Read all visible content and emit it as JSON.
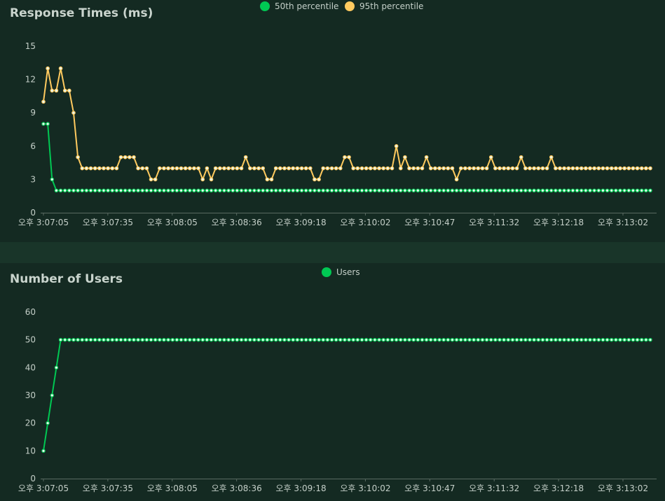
{
  "colors": {
    "background": "#142a22",
    "separator": "#193529",
    "p50": "#00c853",
    "p95": "#ffca5f",
    "users": "#00c853",
    "text": "#c4cfc8",
    "axis": "#5a6b62"
  },
  "chart_data": [
    {
      "type": "line",
      "title": "Response Times (ms)",
      "legend_position": "top-center",
      "x_tick_labels": [
        "오후 3:07:05",
        "오후 3:07:35",
        "오후 3:08:05",
        "오후 3:08:36",
        "오후 3:09:18",
        "오후 3:10:02",
        "오후 3:10:47",
        "오후 3:11:32",
        "오후 3:12:18",
        "오후 3:13:02"
      ],
      "ylim": [
        0,
        15
      ],
      "y_ticks": [
        0,
        3,
        6,
        9,
        12,
        15
      ],
      "series": [
        {
          "name": "50th percentile",
          "color": "#00c853",
          "values": [
            8,
            8,
            3,
            2,
            2,
            2,
            2,
            2,
            2,
            2,
            2,
            2,
            2,
            2,
            2,
            2,
            2,
            2,
            2,
            2,
            2,
            2,
            2,
            2,
            2,
            2,
            2,
            2,
            2,
            2,
            2,
            2,
            2,
            2,
            2,
            2,
            2,
            2,
            2,
            2,
            2,
            2,
            2,
            2,
            2,
            2,
            2,
            2,
            2,
            2,
            2,
            2,
            2,
            2,
            2,
            2,
            2,
            2,
            2,
            2,
            2,
            2,
            2,
            2,
            2,
            2,
            2,
            2,
            2,
            2,
            2,
            2,
            2,
            2,
            2,
            2,
            2,
            2,
            2,
            2,
            2,
            2,
            2,
            2,
            2,
            2,
            2,
            2,
            2,
            2,
            2,
            2,
            2,
            2,
            2,
            2,
            2,
            2,
            2,
            2,
            2,
            2,
            2,
            2,
            2,
            2,
            2,
            2,
            2,
            2,
            2,
            2,
            2,
            2,
            2,
            2,
            2,
            2,
            2,
            2,
            2,
            2,
            2,
            2,
            2,
            2,
            2,
            2,
            2,
            2,
            2,
            2,
            2,
            2,
            2,
            2,
            2,
            2,
            2,
            2,
            2,
            2
          ]
        },
        {
          "name": "95th percentile",
          "color": "#ffca5f",
          "values": [
            10,
            13,
            11,
            11,
            13,
            11,
            11,
            9,
            5,
            4,
            4,
            4,
            4,
            4,
            4,
            4,
            4,
            4,
            5,
            5,
            5,
            5,
            4,
            4,
            4,
            3,
            3,
            4,
            4,
            4,
            4,
            4,
            4,
            4,
            4,
            4,
            4,
            3,
            4,
            3,
            4,
            4,
            4,
            4,
            4,
            4,
            4,
            5,
            4,
            4,
            4,
            4,
            3,
            3,
            4,
            4,
            4,
            4,
            4,
            4,
            4,
            4,
            4,
            3,
            3,
            4,
            4,
            4,
            4,
            4,
            5,
            5,
            4,
            4,
            4,
            4,
            4,
            4,
            4,
            4,
            4,
            4,
            6,
            4,
            5,
            4,
            4,
            4,
            4,
            5,
            4,
            4,
            4,
            4,
            4,
            4,
            3,
            4,
            4,
            4,
            4,
            4,
            4,
            4,
            5,
            4,
            4,
            4,
            4,
            4,
            4,
            5,
            4,
            4,
            4,
            4,
            4,
            4,
            5,
            4,
            4,
            4,
            4,
            4,
            4,
            4,
            4,
            4,
            4,
            4,
            4,
            4,
            4,
            4,
            4,
            4,
            4,
            4,
            4,
            4,
            4,
            4
          ]
        }
      ]
    },
    {
      "type": "line",
      "title": "Number of Users",
      "legend_position": "top-center",
      "x_tick_labels": [
        "오후 3:07:05",
        "오후 3:07:35",
        "오후 3:08:05",
        "오후 3:08:36",
        "오후 3:09:18",
        "오후 3:10:02",
        "오후 3:10:47",
        "오후 3:11:32",
        "오후 3:12:18",
        "오후 3:13:02"
      ],
      "ylim": [
        0,
        60
      ],
      "y_ticks": [
        0,
        10,
        20,
        30,
        40,
        50,
        60
      ],
      "series": [
        {
          "name": "Users",
          "color": "#00c853",
          "values": [
            10,
            20,
            30,
            40,
            50,
            50,
            50,
            50,
            50,
            50,
            50,
            50,
            50,
            50,
            50,
            50,
            50,
            50,
            50,
            50,
            50,
            50,
            50,
            50,
            50,
            50,
            50,
            50,
            50,
            50,
            50,
            50,
            50,
            50,
            50,
            50,
            50,
            50,
            50,
            50,
            50,
            50,
            50,
            50,
            50,
            50,
            50,
            50,
            50,
            50,
            50,
            50,
            50,
            50,
            50,
            50,
            50,
            50,
            50,
            50,
            50,
            50,
            50,
            50,
            50,
            50,
            50,
            50,
            50,
            50,
            50,
            50,
            50,
            50,
            50,
            50,
            50,
            50,
            50,
            50,
            50,
            50,
            50,
            50,
            50,
            50,
            50,
            50,
            50,
            50,
            50,
            50,
            50,
            50,
            50,
            50,
            50,
            50,
            50,
            50,
            50,
            50,
            50,
            50,
            50,
            50,
            50,
            50,
            50,
            50,
            50,
            50,
            50,
            50,
            50,
            50,
            50,
            50,
            50,
            50,
            50,
            50,
            50,
            50,
            50,
            50,
            50,
            50,
            50,
            50,
            50,
            50,
            50,
            50,
            50,
            50,
            50,
            50,
            50,
            50,
            50,
            50
          ]
        }
      ]
    }
  ]
}
